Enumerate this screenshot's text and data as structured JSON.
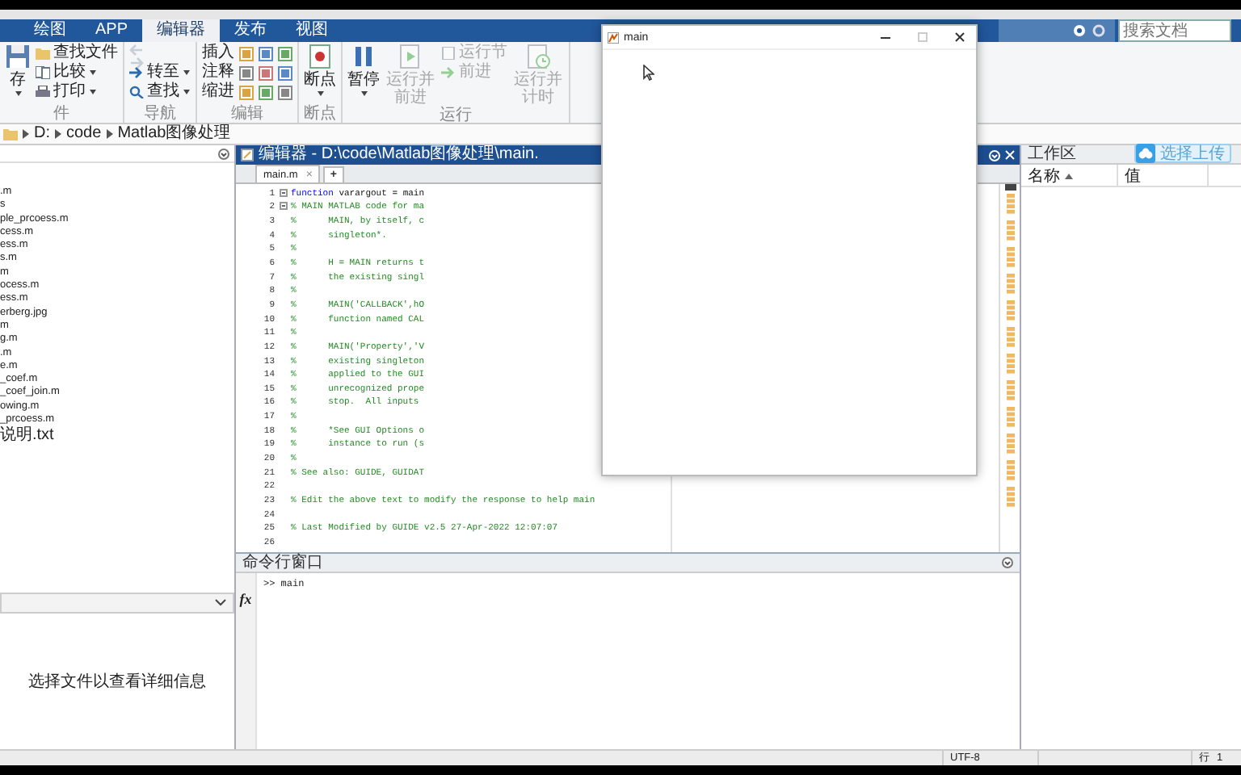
{
  "tabs": [
    {
      "label": "绘图",
      "selected": false
    },
    {
      "label": "APP",
      "selected": false
    },
    {
      "label": "编辑器",
      "selected": true
    },
    {
      "label": "发布",
      "selected": false
    },
    {
      "label": "视图",
      "selected": false
    }
  ],
  "search": {
    "placeholder": "搜索文档"
  },
  "toolstrip": {
    "groups": [
      {
        "label": "件",
        "items": [
          {
            "kind": "large",
            "label": "存",
            "dropdown": true,
            "disabled": false
          },
          {
            "kind": "small",
            "label": "查找文件",
            "dropdown": false,
            "disabled": false
          },
          {
            "kind": "small",
            "label": "比较",
            "dropdown": true,
            "disabled": false
          },
          {
            "kind": "small",
            "label": "打印",
            "dropdown": true,
            "disabled": false
          }
        ]
      },
      {
        "label": "导航",
        "items": [
          {
            "kind": "arrows",
            "disabled": true
          },
          {
            "kind": "small",
            "label": "转至",
            "dropdown": true,
            "disabled": false
          },
          {
            "kind": "small",
            "label": "查找",
            "dropdown": true,
            "disabled": false
          }
        ]
      },
      {
        "label": "编辑",
        "items": [
          {
            "kind": "small",
            "label": "插入",
            "dropdown": false,
            "disabled": false
          },
          {
            "kind": "small",
            "label": "注释",
            "dropdown": false,
            "disabled": false
          },
          {
            "kind": "small",
            "label": "缩进",
            "dropdown": false,
            "disabled": false
          },
          {
            "kind": "icons"
          }
        ]
      },
      {
        "label": "断点",
        "items": [
          {
            "kind": "large",
            "label": "断点",
            "dropdown": true,
            "disabled": false
          }
        ]
      },
      {
        "label": "运行",
        "items": [
          {
            "kind": "large",
            "label": "暂停",
            "dropdown": true,
            "disabled": false
          },
          {
            "kind": "large",
            "label": "运行并前进",
            "dropdown": false,
            "disabled": true
          },
          {
            "kind": "small",
            "label": "运行节",
            "dropdown": false,
            "disabled": true
          },
          {
            "kind": "small",
            "label": "前进",
            "dropdown": false,
            "disabled": true
          },
          {
            "kind": "large",
            "label": "运行并计时",
            "dropdown": false,
            "disabled": true
          }
        ]
      }
    ]
  },
  "path": [
    "D:",
    "code",
    "Matlab图像处理"
  ],
  "file_browser": {
    "files": [
      ".m",
      "s",
      "ple_prcoess.m",
      "cess.m",
      "ess.m",
      "s.m",
      "m",
      "ocess.m",
      "ess.m",
      "erberg.jpg",
      "m",
      "g.m",
      ".m",
      "e.m",
      "_coef.m",
      "_coef_join.m",
      "owing.m",
      "_prcoess.m",
      "说明.txt"
    ],
    "details_message": "选择文件以查看详细信息"
  },
  "editor": {
    "title": "编辑器 - D:\\code\\Matlab图像处理\\main.",
    "tabs": [
      {
        "label": "main.m",
        "selected": true,
        "close": "×"
      }
    ],
    "new_tab": "+",
    "lines": [
      {
        "number": "1",
        "kind": "code",
        "keyword": "function",
        "text": " varargout = main",
        "fold": true
      },
      {
        "number": "2",
        "kind": "comment",
        "text": "% MAIN MATLAB code for ma",
        "fold": true
      },
      {
        "number": "3",
        "kind": "comment",
        "text": "%      MAIN, by itself, c",
        "fold": false
      },
      {
        "number": "4",
        "kind": "comment",
        "text": "%      singleton*.",
        "fold": false
      },
      {
        "number": "5",
        "kind": "comment",
        "text": "%",
        "fold": false
      },
      {
        "number": "6",
        "kind": "comment",
        "text": "%      H = MAIN returns t",
        "fold": false
      },
      {
        "number": "7",
        "kind": "comment",
        "text": "%      the existing singl",
        "fold": false
      },
      {
        "number": "8",
        "kind": "comment",
        "text": "%",
        "fold": false
      },
      {
        "number": "9",
        "kind": "comment",
        "text": "%      MAIN('CALLBACK',hO",
        "fold": false
      },
      {
        "number": "10",
        "kind": "comment",
        "text": "%      function named CAL",
        "fold": false
      },
      {
        "number": "11",
        "kind": "comment",
        "text": "%",
        "fold": false
      },
      {
        "number": "12",
        "kind": "comment",
        "text": "%      MAIN('Property','V",
        "fold": false
      },
      {
        "number": "13",
        "kind": "comment",
        "text": "%      existing singleton",
        "fold": false
      },
      {
        "number": "14",
        "kind": "comment",
        "text": "%      applied to the GUI",
        "fold": false
      },
      {
        "number": "15",
        "kind": "comment",
        "text": "%      unrecognized prope",
        "fold": false
      },
      {
        "number": "16",
        "kind": "comment",
        "text": "%      stop.  All inputs",
        "fold": false
      },
      {
        "number": "17",
        "kind": "comment",
        "text": "%",
        "fold": false
      },
      {
        "number": "18",
        "kind": "comment",
        "text": "%      *See GUI Options o",
        "fold": false
      },
      {
        "number": "19",
        "kind": "comment",
        "text": "%      instance to run (s",
        "fold": false
      },
      {
        "number": "20",
        "kind": "comment",
        "text": "%",
        "fold": false
      },
      {
        "number": "21",
        "kind": "comment",
        "text": "% See also: GUIDE, GUIDAT",
        "fold": false
      },
      {
        "number": "22",
        "kind": "blank",
        "fold": false
      },
      {
        "number": "23",
        "kind": "comment",
        "text": "% Edit the above text to modify the response to help main",
        "fold": false
      },
      {
        "number": "24",
        "kind": "blank",
        "fold": false
      },
      {
        "number": "25",
        "kind": "comment",
        "text": "% Last Modified by GUIDE v2.5 27-Apr-2022 12:07:07",
        "fold": false
      },
      {
        "number": "26",
        "kind": "blank",
        "fold": false
      }
    ]
  },
  "command_window": {
    "title": "命令行窗口",
    "prompt_icon": "fx",
    "lines": [
      ">> main"
    ]
  },
  "workspace": {
    "title": "工作区",
    "columns": [
      {
        "label": "名称",
        "sorted": true
      },
      {
        "label": "值",
        "sorted": false
      }
    ]
  },
  "upload_badge": {
    "label": "选择上传"
  },
  "status_bar": {
    "encoding": "UTF-8",
    "line_label": "行",
    "line": "1"
  },
  "figure_window": {
    "title": "main"
  }
}
